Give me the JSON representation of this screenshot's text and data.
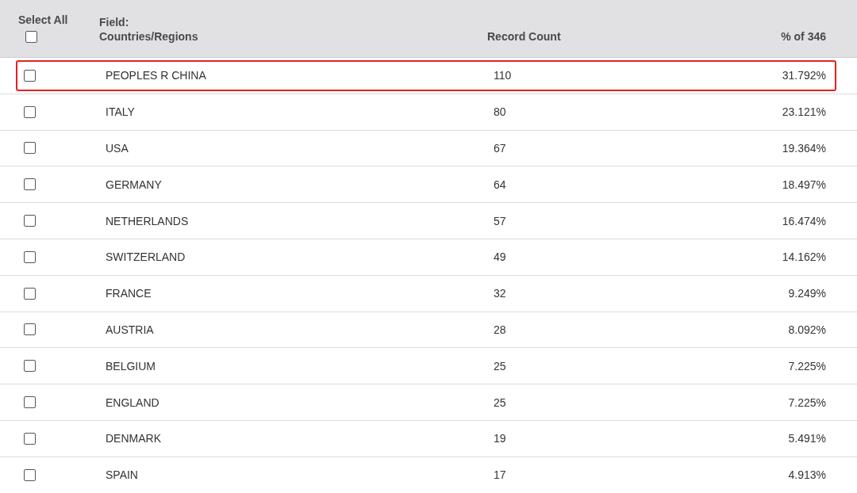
{
  "header": {
    "select_all": {
      "label": "Select All",
      "checked": false
    },
    "field_label": "Field:",
    "field_value": "Countries/Regions",
    "count_label": "Record Count",
    "percent_label": "% of 346"
  },
  "rows": [
    {
      "name": "PEOPLES R CHINA",
      "count": "110",
      "percent": "31.792%",
      "checked": false,
      "highlighted": true
    },
    {
      "name": "ITALY",
      "count": "80",
      "percent": "23.121%",
      "checked": false,
      "highlighted": false
    },
    {
      "name": "USA",
      "count": "67",
      "percent": "19.364%",
      "checked": false,
      "highlighted": false
    },
    {
      "name": "GERMANY",
      "count": "64",
      "percent": "18.497%",
      "checked": false,
      "highlighted": false
    },
    {
      "name": "NETHERLANDS",
      "count": "57",
      "percent": "16.474%",
      "checked": false,
      "highlighted": false
    },
    {
      "name": "SWITZERLAND",
      "count": "49",
      "percent": "14.162%",
      "checked": false,
      "highlighted": false
    },
    {
      "name": "FRANCE",
      "count": "32",
      "percent": "9.249%",
      "checked": false,
      "highlighted": false
    },
    {
      "name": "AUSTRIA",
      "count": "28",
      "percent": "8.092%",
      "checked": false,
      "highlighted": false
    },
    {
      "name": "BELGIUM",
      "count": "25",
      "percent": "7.225%",
      "checked": false,
      "highlighted": false
    },
    {
      "name": "ENGLAND",
      "count": "25",
      "percent": "7.225%",
      "checked": false,
      "highlighted": false
    },
    {
      "name": "DENMARK",
      "count": "19",
      "percent": "5.491%",
      "checked": false,
      "highlighted": false
    },
    {
      "name": "SPAIN",
      "count": "17",
      "percent": "4.913%",
      "checked": false,
      "highlighted": false
    }
  ]
}
